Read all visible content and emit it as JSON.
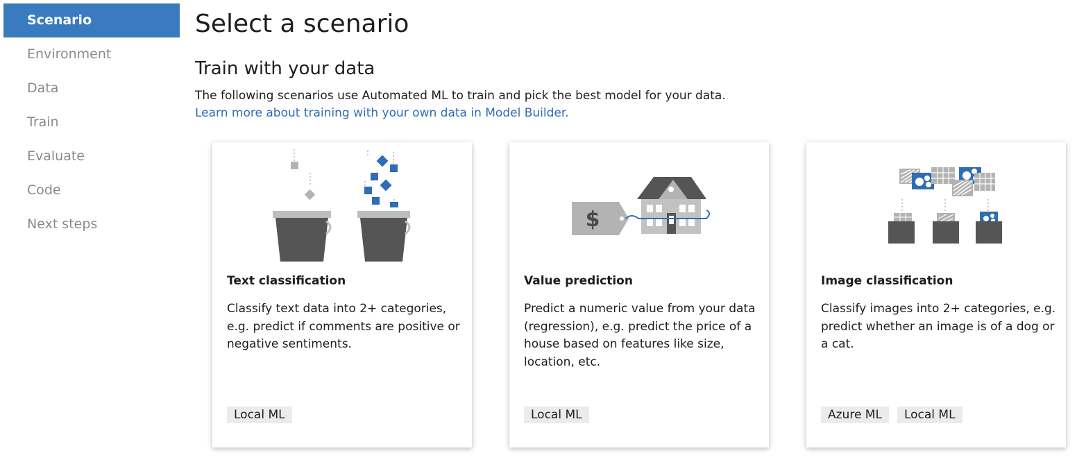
{
  "sidebar": {
    "items": [
      {
        "label": "Scenario",
        "active": true
      },
      {
        "label": "Environment"
      },
      {
        "label": "Data"
      },
      {
        "label": "Train"
      },
      {
        "label": "Evaluate"
      },
      {
        "label": "Code"
      },
      {
        "label": "Next steps"
      }
    ]
  },
  "main": {
    "title": "Select a scenario",
    "section_title": "Train with your data",
    "description": "The following scenarios use Automated ML to train and pick the best model for your data.",
    "learn_more_link": "Learn more about training with your own data in Model Builder."
  },
  "cards": [
    {
      "title": "Text classification",
      "description": "Classify text data into 2+ categories, e.g. predict if comments are positive or negative sentiments.",
      "tags": [
        "Local ML"
      ],
      "icon": "buckets-icon"
    },
    {
      "title": "Value prediction",
      "description": "Predict a numeric value from your data (regression), e.g. predict the price of a house based on features like size, location, etc.",
      "tags": [
        "Local ML"
      ],
      "icon": "house-price-icon",
      "price_symbol": "$"
    },
    {
      "title": "Image classification",
      "description": "Classify images into 2+ categories, e.g. predict whether an image is of a dog or a cat.",
      "tags": [
        "Azure ML",
        "Local ML"
      ],
      "icon": "image-folders-icon"
    }
  ],
  "colors": {
    "accent": "#3a7bc0",
    "link": "#2d6db5",
    "icon_blue": "#2f6db4",
    "icon_gray": "#b3b3b3",
    "icon_dark": "#555555",
    "tag_bg": "#ebebeb",
    "nav_inactive": "#8a8a8a"
  }
}
